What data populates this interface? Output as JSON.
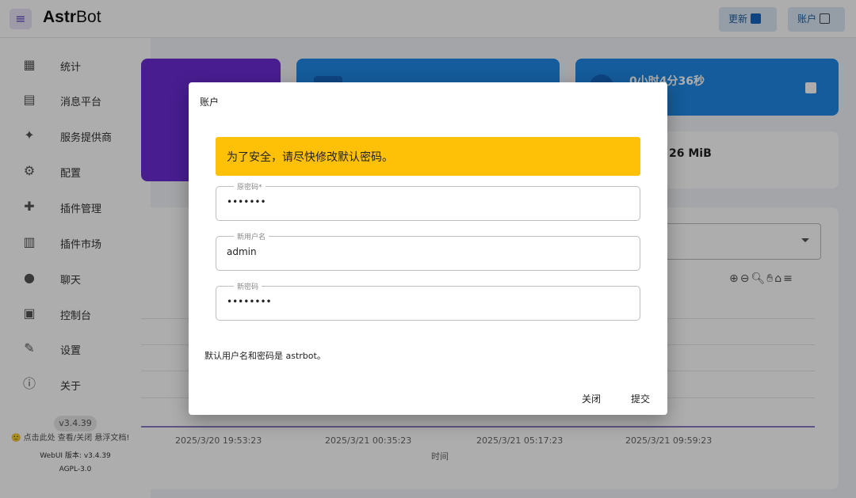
{
  "header": {
    "logo_bold": "Astr",
    "logo_rest": "Bot",
    "update_label": "更新",
    "account_label": "账户"
  },
  "sidebar": {
    "items": [
      {
        "label": "统计",
        "icon": "dashboard-icon"
      },
      {
        "label": "消息平台",
        "icon": "message-icon"
      },
      {
        "label": "服务提供商",
        "icon": "sparkle-icon"
      },
      {
        "label": "配置",
        "icon": "gear-icon"
      },
      {
        "label": "插件管理",
        "icon": "puzzle-icon"
      },
      {
        "label": "插件市场",
        "icon": "store-icon"
      },
      {
        "label": "聊天",
        "icon": "chat-icon"
      },
      {
        "label": "控制台",
        "icon": "terminal-icon"
      },
      {
        "label": "设置",
        "icon": "wrench-icon"
      },
      {
        "label": "关于",
        "icon": "info-icon"
      }
    ],
    "version_chip": "v3.4.39",
    "tip": "🙂 点击此处 查看/关闭 悬浮文档!",
    "webui_version": "WebUI 版本: v3.4.39",
    "license": "AGPL-3.0"
  },
  "dashboard": {
    "uptime": "0小时4分36秒",
    "memory": "26 MiB",
    "chart": {
      "x_ticks": [
        "2025/3/20 19:53:23",
        "2025/3/21 00:35:23",
        "2025/3/21 05:17:23",
        "2025/3/21 09:59:23"
      ],
      "x_label": "时间"
    }
  },
  "dialog": {
    "title": "账户",
    "alert": "为了安全，请尽快修改默认密码。",
    "fields": [
      {
        "label": "原密码*",
        "value": "•••••••"
      },
      {
        "label": "新用户名",
        "value": "admin"
      },
      {
        "label": "新密码",
        "value": "••••••••"
      }
    ],
    "hint": "默认用户名和密码是 astrbot。",
    "close_label": "关闭",
    "submit_label": "提交"
  }
}
